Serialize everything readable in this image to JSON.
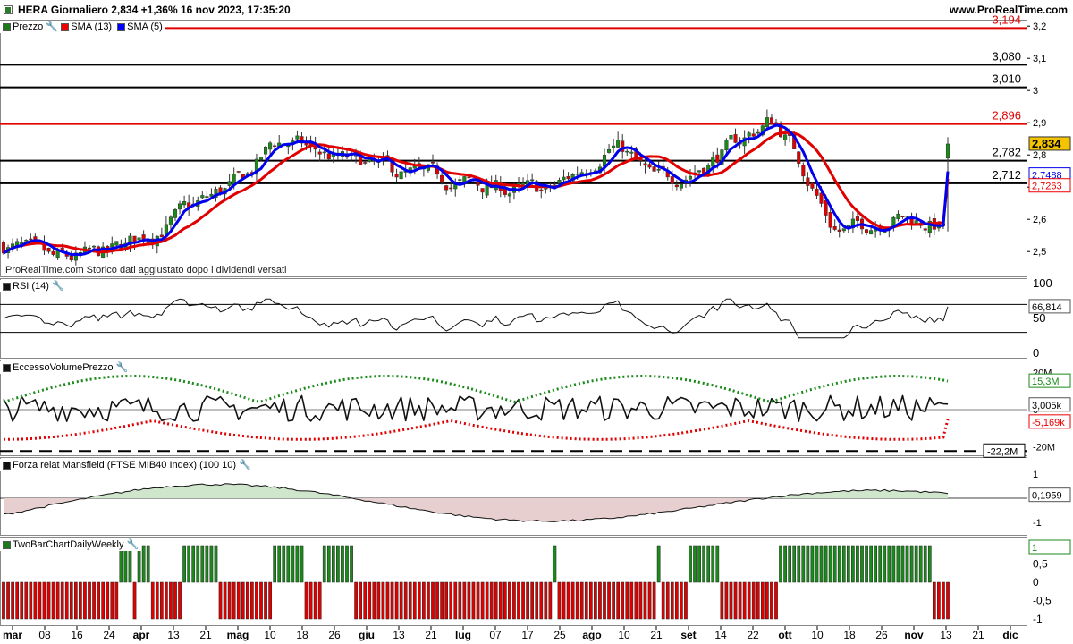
{
  "header": {
    "title": "HERA Giornaliero 2,834 +1,36% 16 nov 2023, 17:35:20",
    "site": "www.ProRealTime.com"
  },
  "price_panel": {
    "labels": [
      "Prezzo",
      "SMA (13)",
      "SMA (5)"
    ],
    "axis_ticks": [
      "3,2",
      "3,1",
      "3",
      "2,9",
      "2,8",
      "2,7",
      "2,6",
      "2,5"
    ],
    "hlines": [
      {
        "value": "3,194",
        "color": "#e00000"
      },
      {
        "value": "3,080",
        "color": "#000000"
      },
      {
        "value": "3,010",
        "color": "#000000"
      },
      {
        "value": "2,896",
        "color": "#e00000"
      },
      {
        "value": "2,782",
        "color": "#000000"
      },
      {
        "value": "2,712",
        "color": "#000000"
      }
    ],
    "last_price": "2,834",
    "sma5_value": "2,7488",
    "sma13_value": "2,7263",
    "footnote": "ProRealTime.com  Storico dati aggiustato dopo i dividendi versati"
  },
  "rsi_panel": {
    "label": "RSI (14)",
    "axis_ticks": [
      "100",
      "50",
      "0"
    ],
    "value": "66,814"
  },
  "volume_panel": {
    "label": "EccessoVolumePrezzo",
    "axis_ticks": [
      "20M",
      "0",
      "-20M"
    ],
    "values": [
      "15,3M",
      "3,005k",
      "-5,169k",
      "-22,2M"
    ]
  },
  "mansfield_panel": {
    "label": "Forza relat Mansfield (FTSE MIB40 Index) (100 10)",
    "axis_ticks": [
      "1",
      "-1"
    ],
    "value": "0,1959"
  },
  "twobar_panel": {
    "label": "TwoBarChartDailyWeekly",
    "axis_ticks": [
      "1",
      "0,5",
      "0",
      "-0,5",
      "-1"
    ],
    "value": "1"
  },
  "time_axis": [
    "mar",
    "08",
    "16",
    "24",
    "apr",
    "13",
    "21",
    "mag",
    "10",
    "18",
    "26",
    "giu",
    "13",
    "21",
    "lug",
    "07",
    "17",
    "25",
    "ago",
    "10",
    "21",
    "set",
    "14",
    "22",
    "ott",
    "10",
    "18",
    "26",
    "nov",
    "13",
    "21",
    "dic"
  ],
  "colors": {
    "up": "#1a8a1a",
    "down": "#e00000",
    "sma13": "#e00000",
    "sma5": "#0000ee"
  }
}
